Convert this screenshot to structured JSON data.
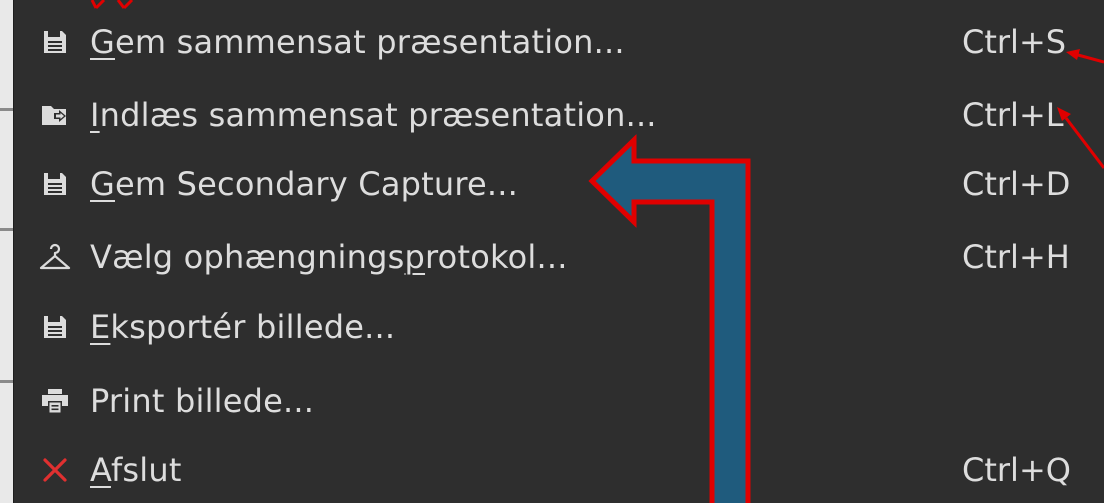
{
  "menu": {
    "items": [
      {
        "pre": "",
        "accel": "G",
        "post": "em sammensat præsentation...",
        "shortcut": "Ctrl+S",
        "icon": "save-icon"
      },
      {
        "pre": "",
        "accel": "I",
        "post": "ndlæs sammensat præsentation...",
        "shortcut": "Ctrl+L",
        "icon": "folder-open-icon"
      },
      {
        "pre": "",
        "accel": "G",
        "post": "em Secondary Capture...",
        "shortcut": "Ctrl+D",
        "icon": "save-icon"
      },
      {
        "pre": "Vælg ophængnings",
        "accel": "p",
        "post": "rotokol...",
        "shortcut": "Ctrl+H",
        "icon": "hanger-icon"
      },
      {
        "pre": "",
        "accel": "E",
        "post": "ksportér billede...",
        "shortcut": "",
        "icon": "save-icon"
      },
      {
        "pre": "Print billede...",
        "accel": "",
        "post": "",
        "shortcut": "",
        "icon": "printer-icon"
      },
      {
        "pre": "",
        "accel": "A",
        "post": "fslut",
        "shortcut": "Ctrl+Q",
        "icon": "close-icon"
      }
    ]
  },
  "colors": {
    "menu_bg": "#2e2e2e",
    "menu_text": "#dddddd",
    "annotation_red": "#e00000",
    "arrow_fill": "#1f5b7d",
    "quit_icon": "#e03030"
  }
}
